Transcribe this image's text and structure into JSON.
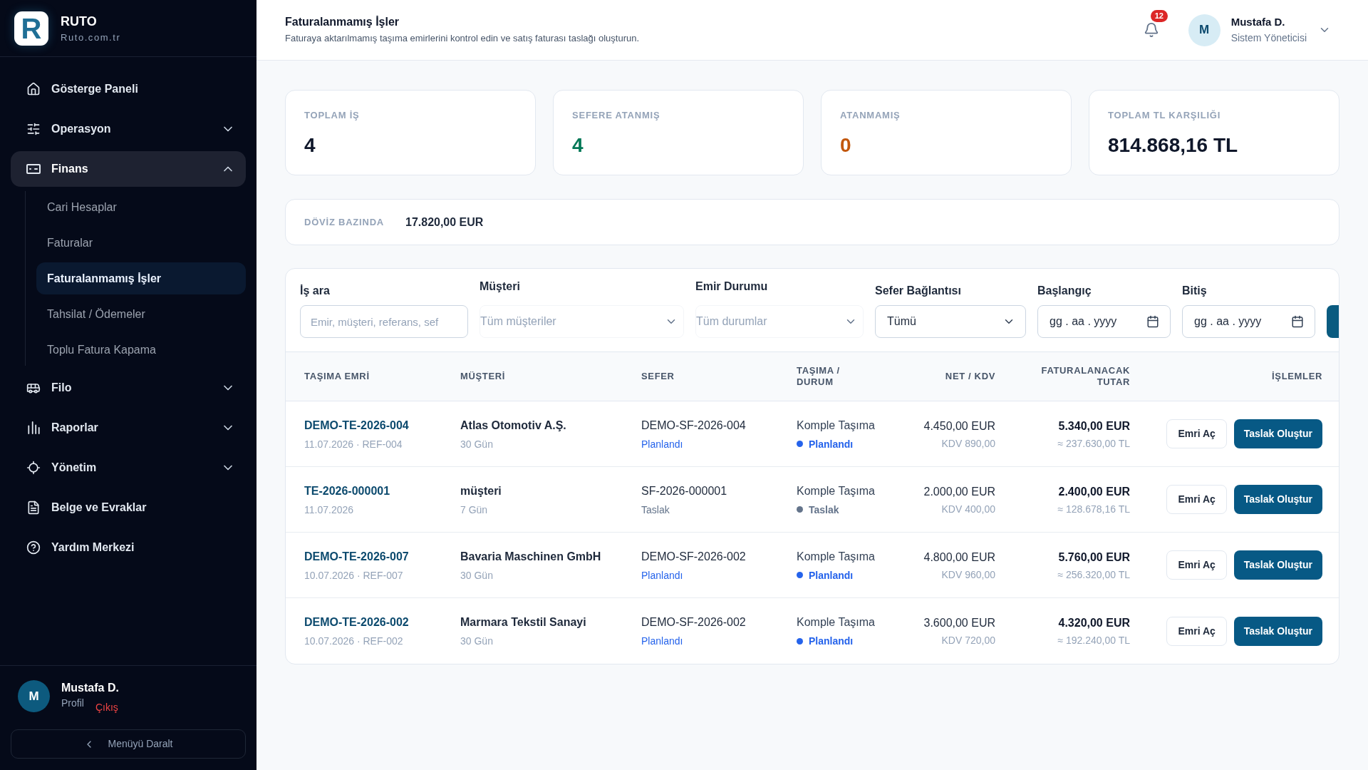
{
  "sidebar": {
    "brand": {
      "logo_letter": "R",
      "name": "RUTO",
      "domain": "Ruto.com.tr"
    },
    "nav": [
      {
        "label": "Gösterge Paneli",
        "kind": "link",
        "selected": false
      },
      {
        "label": "Operasyon",
        "kind": "group",
        "selected": false,
        "expanded": false
      },
      {
        "label": "Finans",
        "kind": "group",
        "selected": true,
        "expanded": true,
        "children": [
          {
            "label": "Cari Hesaplar",
            "selected": false
          },
          {
            "label": "Faturalar",
            "selected": false
          },
          {
            "label": "Faturalanmamış İşler",
            "selected": true
          },
          {
            "label": "Tahsilat / Ödemeler",
            "selected": false
          },
          {
            "label": "Toplu Fatura Kapama",
            "selected": false
          }
        ]
      },
      {
        "label": "Filo",
        "kind": "group",
        "selected": false,
        "expanded": false
      },
      {
        "label": "Raporlar",
        "kind": "group",
        "selected": false,
        "expanded": false
      },
      {
        "label": "Yönetim",
        "kind": "group",
        "selected": false,
        "expanded": false
      },
      {
        "label": "Belge ve Evraklar",
        "kind": "link",
        "selected": false
      },
      {
        "label": "Yardım Merkezi",
        "kind": "link",
        "selected": false
      }
    ],
    "user": {
      "initial": "M",
      "name": "Mustafa D.",
      "profile_link": "Profil",
      "logout_link": "Çıkış"
    },
    "collapse_button": "Menüyü Daralt"
  },
  "header": {
    "title": "Faturalanmamış İşler",
    "subtitle": "Faturaya aktarılmamış taşıma emirlerini kontrol edin ve satış faturası taslağı oluşturun.",
    "notification_count": "12",
    "user": {
      "initial": "M",
      "name": "Mustafa D.",
      "role": "Sistem Yöneticisi"
    }
  },
  "stats": [
    {
      "label": "TOPLAM İŞ",
      "value": "4",
      "color": "#0f172a"
    },
    {
      "label": "SEFERE ATANMIŞ",
      "value": "4",
      "color": "#047857"
    },
    {
      "label": "ATANMAMIŞ",
      "value": "0",
      "color": "#c2570c"
    },
    {
      "label": "TOPLAM TL KARŞILIĞI",
      "value": "814.868,16 TL",
      "color": "#0f172a"
    }
  ],
  "currency_summary": {
    "label": "DÖVİZ BAZINDA",
    "value": "17.820,00 EUR"
  },
  "filters": [
    {
      "label": "İş ara",
      "kind": "text",
      "placeholder": "Emir, müşteri, referans, sef"
    },
    {
      "label": "Müşteri",
      "kind": "combo",
      "placeholder": "Tüm müşteriler"
    },
    {
      "label": "Emir Durumu",
      "kind": "combo",
      "placeholder": "Tüm durumlar"
    },
    {
      "label": "Sefer Bağlantısı",
      "kind": "select",
      "value": "Tümü"
    },
    {
      "label": "Başlangıç",
      "kind": "date",
      "placeholder": "gg . aa . yyyy"
    },
    {
      "label": "Bitiş",
      "kind": "date",
      "placeholder": "gg . aa . yyyy"
    }
  ],
  "table": {
    "columns": [
      "TAŞIMA EMRİ",
      "MÜŞTERİ",
      "SEFER",
      "TAŞIMA / DURUM",
      "NET / KDV",
      "FATURALANACAK TUTAR",
      "İŞLEMLER"
    ],
    "rows": [
      {
        "order_no": "DEMO-TE-2026-004",
        "order_meta": "11.07.2026 · REF-004",
        "customer": "Atlas Otomotiv A.Ş.",
        "term": "30 Gün",
        "trip_no": "DEMO-SF-2026-004",
        "trip_status": {
          "label": "Planlandı",
          "color": "#2563eb"
        },
        "transport_type": "Komple Taşıma",
        "status": {
          "label": "Planlandı",
          "color": "#2563eb"
        },
        "net": "4.450,00 EUR",
        "vat": "KDV 890,00",
        "invoice_total": "5.340,00 EUR",
        "invoice_total_try": "≈ 237.630,00 TL",
        "actions": [
          {
            "label": "Emri Aç",
            "kind": "secondary"
          },
          {
            "label": "Taslak Oluştur",
            "kind": "primary"
          }
        ]
      },
      {
        "order_no": "TE-2026-000001",
        "order_meta": "11.07.2026",
        "customer": "müşteri",
        "term": "7 Gün",
        "trip_no": "SF-2026-000001",
        "trip_status": {
          "label": "Taslak",
          "color": "#64748b"
        },
        "transport_type": "Komple Taşıma",
        "status": {
          "label": "Taslak",
          "color": "#64748b"
        },
        "net": "2.000,00 EUR",
        "vat": "KDV 400,00",
        "invoice_total": "2.400,00 EUR",
        "invoice_total_try": "≈ 128.678,16 TL",
        "actions": [
          {
            "label": "Emri Aç",
            "kind": "secondary"
          },
          {
            "label": "Taslak Oluştur",
            "kind": "primary"
          }
        ]
      },
      {
        "order_no": "DEMO-TE-2026-007",
        "order_meta": "10.07.2026 · REF-007",
        "customer": "Bavaria Maschinen GmbH",
        "term": "30 Gün",
        "trip_no": "DEMO-SF-2026-002",
        "trip_status": {
          "label": "Planlandı",
          "color": "#2563eb"
        },
        "transport_type": "Komple Taşıma",
        "status": {
          "label": "Planlandı",
          "color": "#2563eb"
        },
        "net": "4.800,00 EUR",
        "vat": "KDV 960,00",
        "invoice_total": "5.760,00 EUR",
        "invoice_total_try": "≈ 256.320,00 TL",
        "actions": [
          {
            "label": "Emri Aç",
            "kind": "secondary"
          },
          {
            "label": "Taslak Oluştur",
            "kind": "primary"
          }
        ]
      },
      {
        "order_no": "DEMO-TE-2026-002",
        "order_meta": "10.07.2026 · REF-002",
        "customer": "Marmara Tekstil Sanayi",
        "term": "30 Gün",
        "trip_no": "DEMO-SF-2026-002",
        "trip_status": {
          "label": "Planlandı",
          "color": "#2563eb"
        },
        "transport_type": "Komple Taşıma",
        "status": {
          "label": "Planlandı",
          "color": "#2563eb"
        },
        "net": "3.600,00 EUR",
        "vat": "KDV 720,00",
        "invoice_total": "4.320,00 EUR",
        "invoice_total_try": "≈ 192.240,00 TL",
        "actions": [
          {
            "label": "Emri Aç",
            "kind": "secondary"
          },
          {
            "label": "Taslak Oluştur",
            "kind": "primary"
          }
        ]
      }
    ]
  }
}
